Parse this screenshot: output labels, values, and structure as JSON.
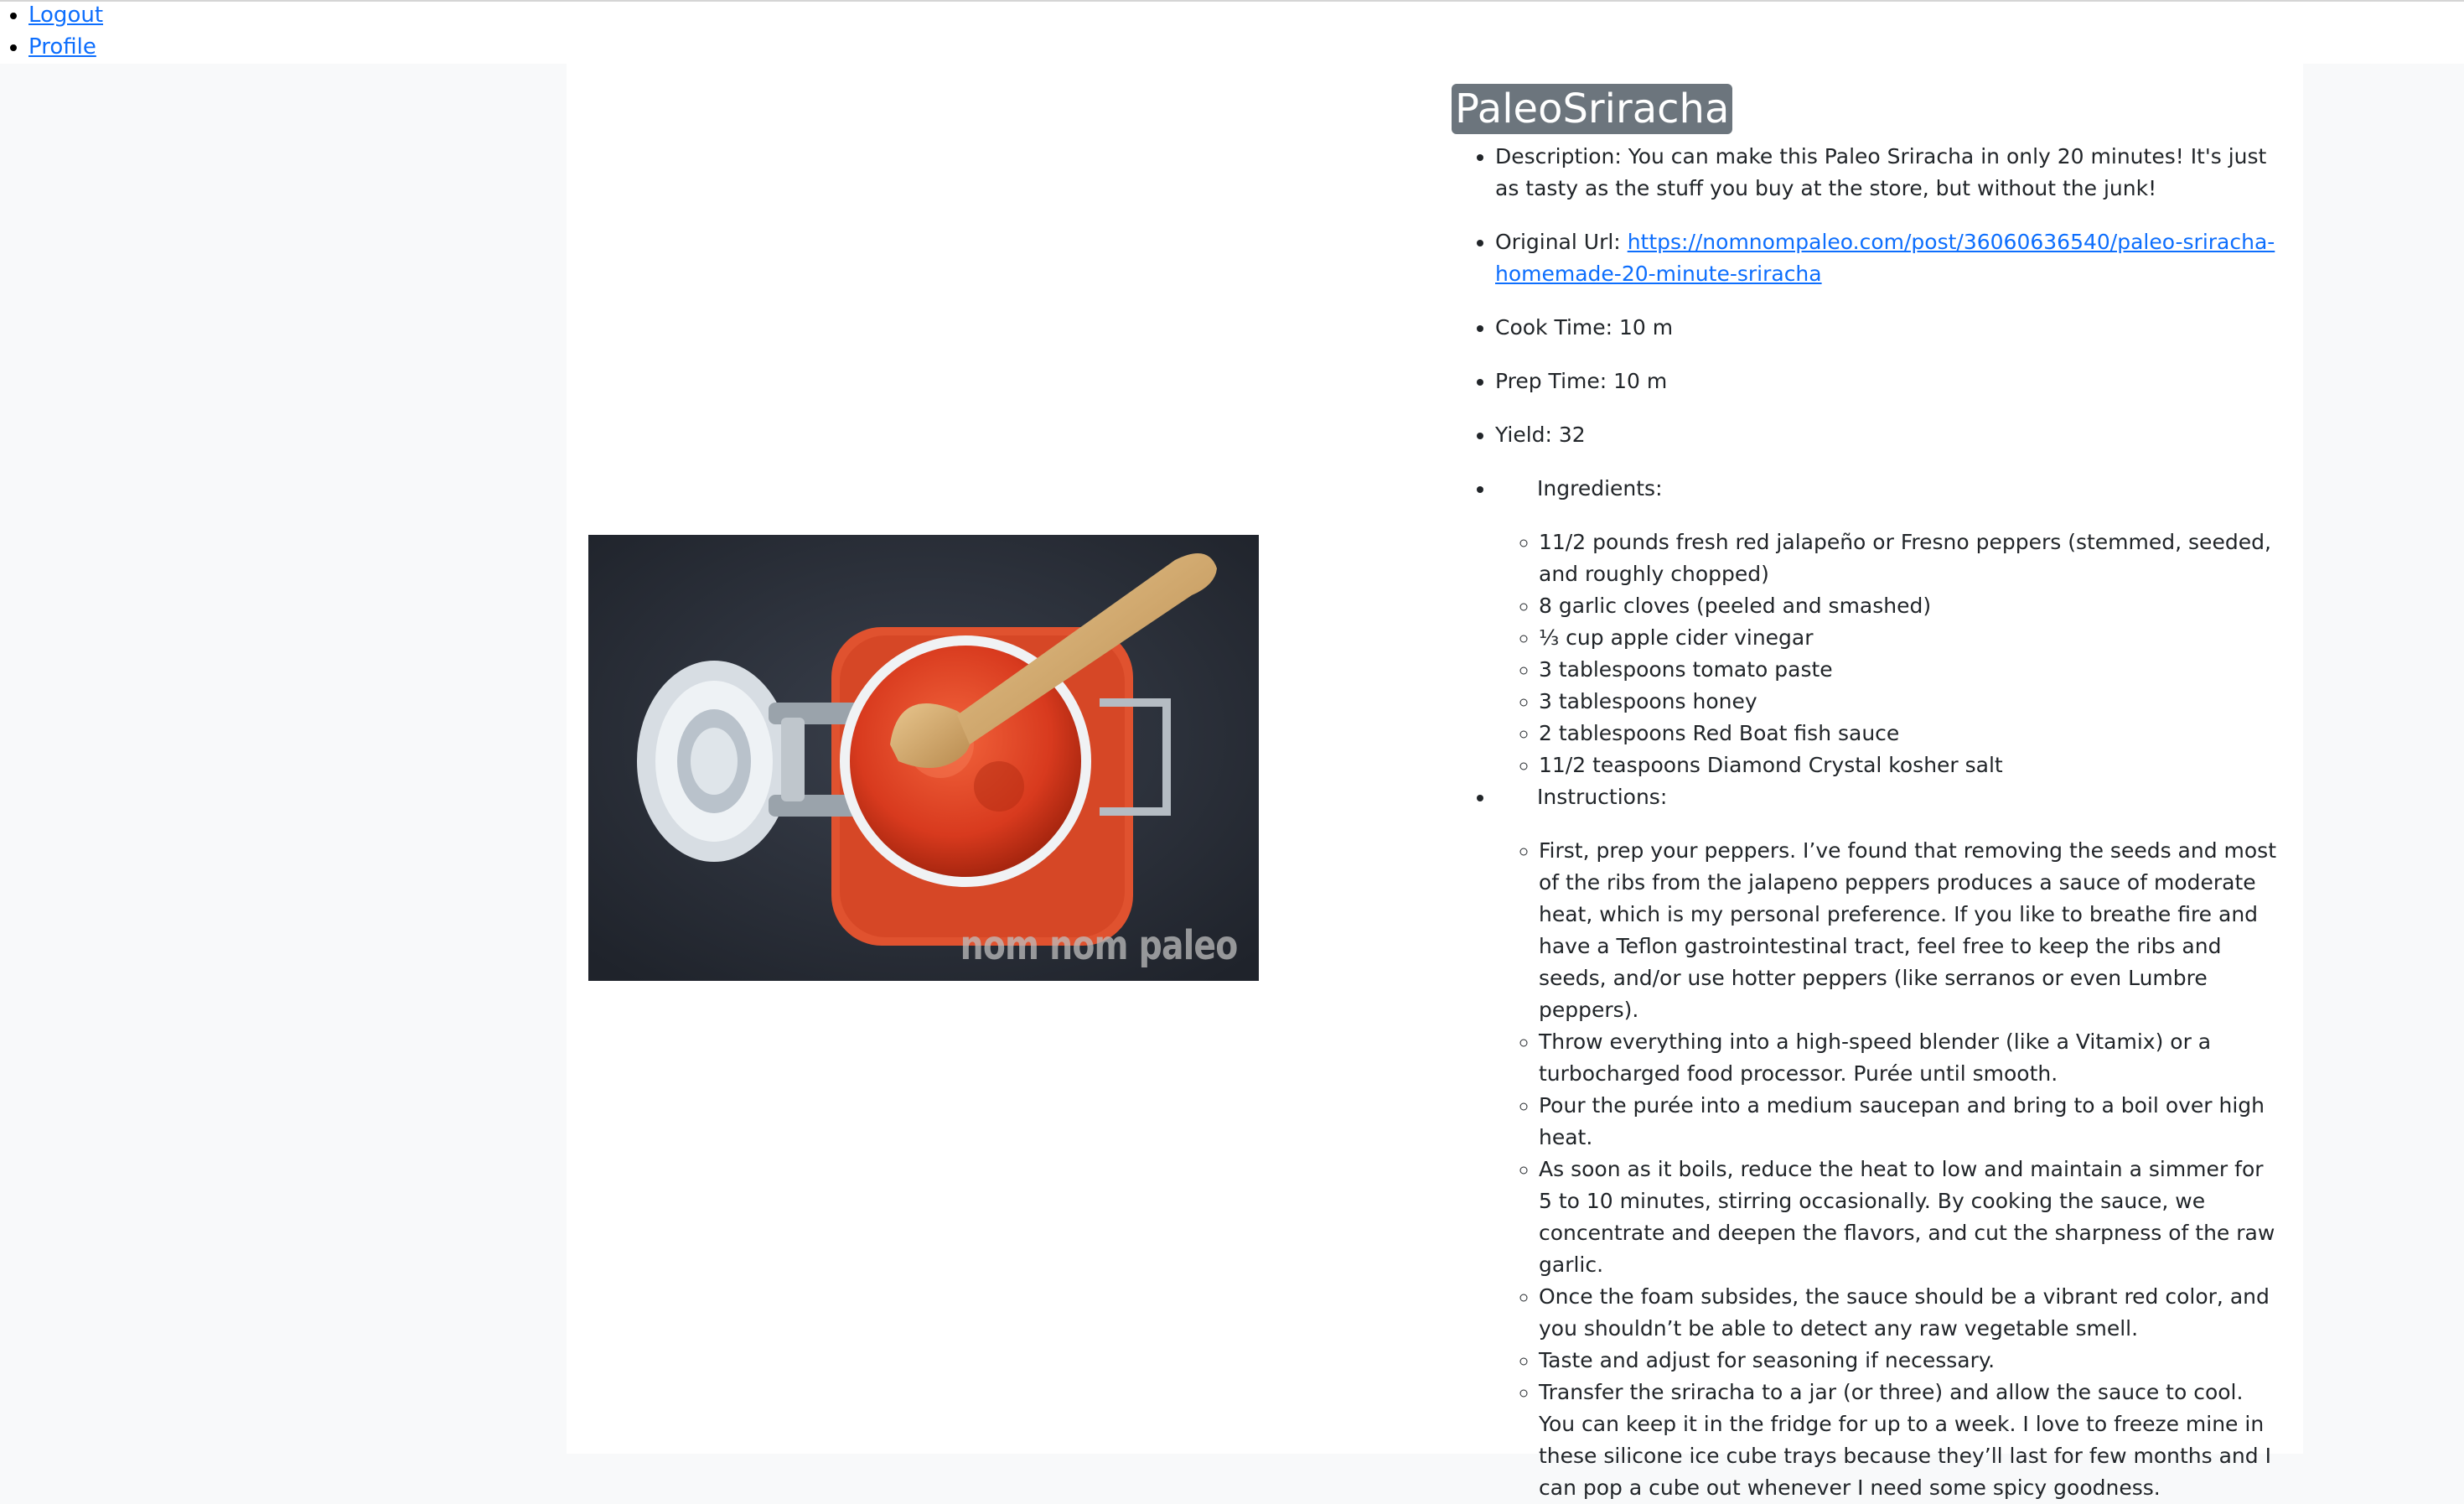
{
  "nav": {
    "logout": "Logout",
    "profile": "Profile"
  },
  "image": {
    "watermark": "nom nom paleo"
  },
  "recipe": {
    "title": "PaleoSriracha",
    "description_label": "Description:",
    "description": "You can make this Paleo Sriracha in only 20 minutes! It's just as tasty as the stuff you buy at the store, but without the junk!",
    "url_label": "Original Url:",
    "url": "https://nomnompaleo.com/post/36060636540/paleo-sriracha-homemade-20-minute-sriracha",
    "cook_time_label": "Cook Time:",
    "cook_time": "10 m",
    "prep_time_label": "Prep Time:",
    "prep_time": "10 m",
    "yield_label": "Yield:",
    "yield": "32",
    "ingredients_label": "Ingredients:",
    "ingredients": [
      "11/2 pounds fresh red jalapeño or Fresno peppers (stemmed, seeded, and roughly chopped)",
      "8 garlic cloves (peeled and smashed)",
      "⅓ cup apple cider vinegar",
      "3 tablespoons tomato paste",
      "3 tablespoons honey",
      "2 tablespoons Red Boat fish sauce",
      "11/2 teaspoons Diamond Crystal kosher salt"
    ],
    "instructions_label": "Instructions:",
    "instructions": [
      "First, prep your peppers. I’ve found that removing the seeds and most of the ribs from the jalapeno peppers produces a sauce of moderate heat, which is my personal preference. If you like to breathe fire and have a Teflon gastrointestinal tract, feel free to keep the ribs and seeds, and/or use hotter peppers (like serranos or even Lumbre peppers).",
      "Throw everything into a high-speed blender (like a Vitamix) or a turbocharged food processor. Purée until smooth.",
      "Pour the purée into a medium saucepan and bring to a boil over high heat.",
      "As soon as it boils, reduce the heat to low and maintain a simmer for 5 to 10 minutes, stirring occasionally. By cooking the sauce, we concentrate and deepen the flavors, and cut the sharpness of the raw garlic.",
      "Once the foam subsides, the sauce should be a vibrant red color, and you shouldn’t be able to detect any raw vegetable smell.",
      "Taste and adjust for seasoning if necessary.",
      "Transfer the sriracha to a jar (or three) and allow the sauce to cool. You can keep it in the fridge for up to a week. I love to freeze mine in these silicone ice cube trays because they’ll last for few months and I can pop a cube out whenever I need some spicy goodness."
    ]
  }
}
